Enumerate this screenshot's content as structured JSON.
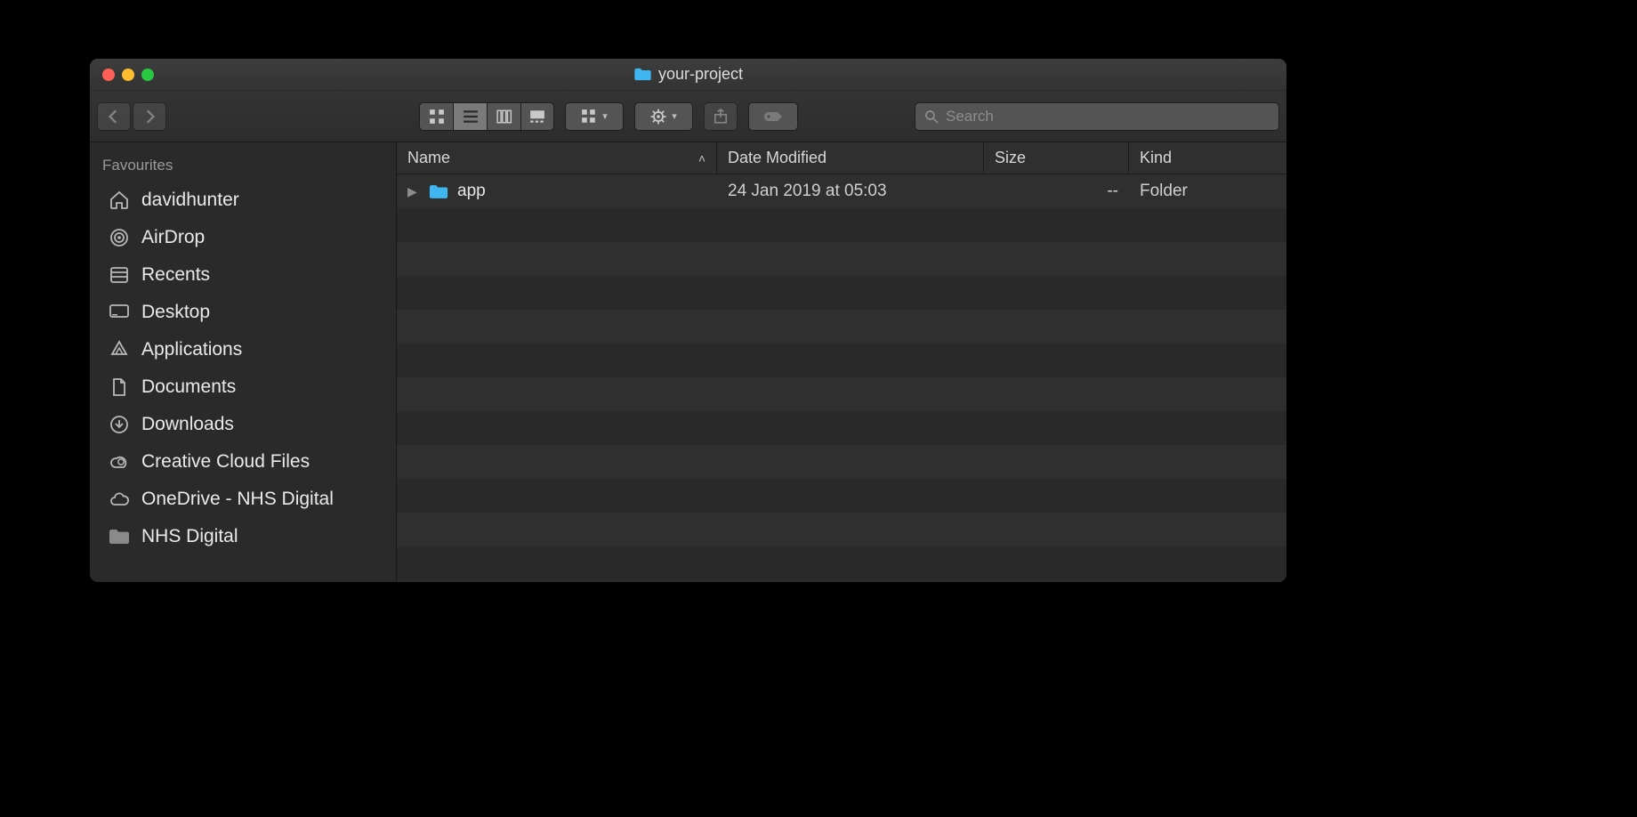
{
  "window": {
    "title": "your-project"
  },
  "search": {
    "placeholder": "Search",
    "value": ""
  },
  "sidebar": {
    "header": "Favourites",
    "items": [
      {
        "icon": "home-icon",
        "label": "davidhunter"
      },
      {
        "icon": "airdrop-icon",
        "label": "AirDrop"
      },
      {
        "icon": "recents-icon",
        "label": "Recents"
      },
      {
        "icon": "desktop-icon",
        "label": "Desktop"
      },
      {
        "icon": "applications-icon",
        "label": "Applications"
      },
      {
        "icon": "documents-icon",
        "label": "Documents"
      },
      {
        "icon": "downloads-icon",
        "label": "Downloads"
      },
      {
        "icon": "creative-cloud-icon",
        "label": "Creative Cloud Files"
      },
      {
        "icon": "onedrive-icon",
        "label": "OneDrive - NHS Digital"
      },
      {
        "icon": "folder-icon",
        "label": "NHS Digital"
      }
    ]
  },
  "columns": {
    "name": "Name",
    "date": "Date Modified",
    "size": "Size",
    "kind": "Kind"
  },
  "rows": [
    {
      "name": "app",
      "date": "24 Jan 2019 at 05:03",
      "size": "--",
      "kind": "Folder"
    }
  ],
  "colors": {
    "folder": "#3fb6ef"
  }
}
